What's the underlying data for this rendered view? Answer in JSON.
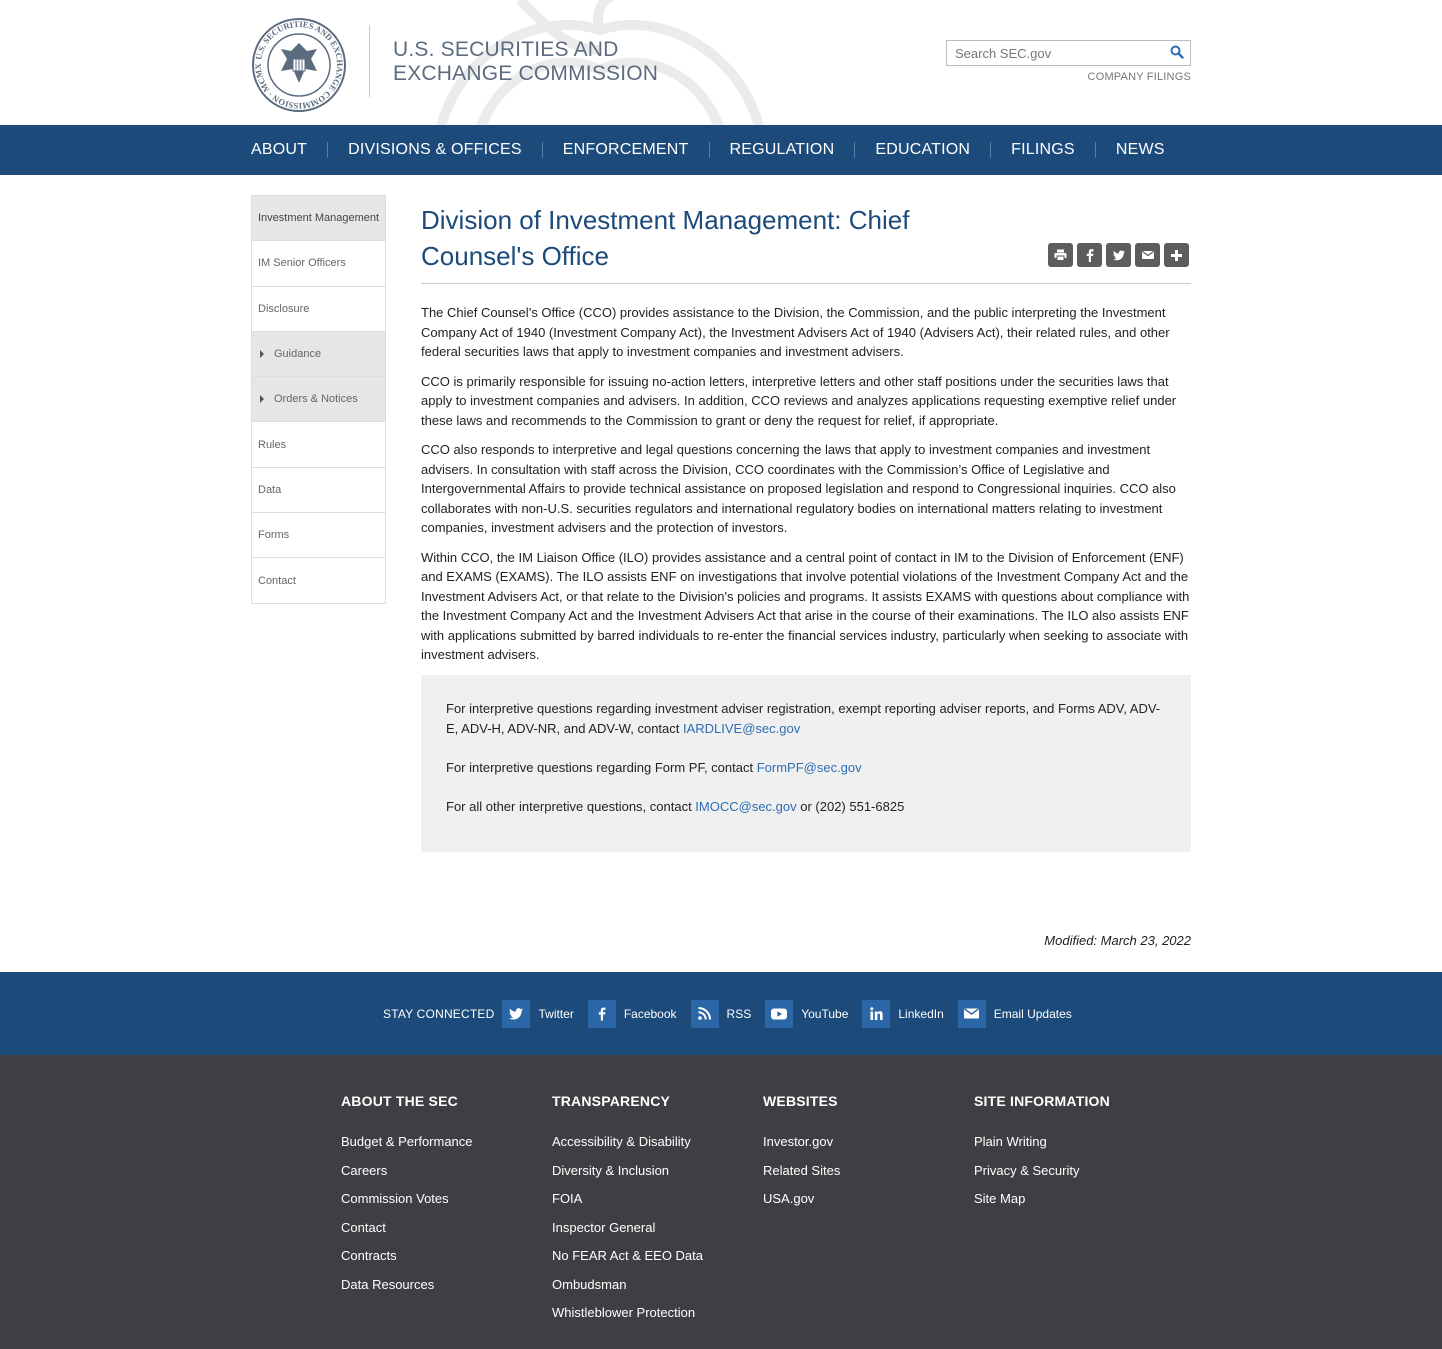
{
  "header": {
    "agency_line1": "U.S. SECURITIES AND",
    "agency_line2": "EXCHANGE COMMISSION",
    "seal_text": "U.S. SECURITIES AND EXCHANGE COMMISSION · MCMXXXIV",
    "search_placeholder": "Search SEC.gov",
    "company_filings": "COMPANY FILINGS"
  },
  "nav": {
    "items": [
      "ABOUT",
      "DIVISIONS & OFFICES",
      "ENFORCEMENT",
      "REGULATION",
      "EDUCATION",
      "FILINGS",
      "NEWS"
    ]
  },
  "sidebar": {
    "items": [
      {
        "label": "Investment Management"
      },
      {
        "label": "IM Senior Officers"
      },
      {
        "label": "Disclosure"
      },
      {
        "label": "Guidance"
      },
      {
        "label": "Orders & Notices"
      },
      {
        "label": "Rules"
      },
      {
        "label": "Data"
      },
      {
        "label": "Forms"
      },
      {
        "label": "Contact"
      }
    ]
  },
  "main": {
    "title": "Division of Investment Management: Chief Counsel's Office",
    "share_icons": [
      "print-icon",
      "facebook-icon",
      "twitter-icon",
      "email-icon",
      "plus-icon"
    ],
    "paragraphs": [
      "The Chief Counsel’s Office (CCO) provides assistance to the Division, the Commission, and the public interpreting the Investment Company Act of 1940 (Investment Company Act), the Investment Advisers Act of 1940 (Advisers Act), their related rules, and other federal securities laws that apply to investment companies and investment advisers.",
      "CCO is primarily responsible for issuing no-action letters, interpretive letters and other staff positions under the securities laws that apply to investment companies and advisers. In addition, CCO reviews and analyzes applications requesting exemptive relief under these laws and recommends to the Commission to grant or deny the request for relief, if appropriate.",
      "CCO also responds to interpretive and legal questions concerning the laws that apply to investment companies and investment advisers. In consultation with staff across the Division, CCO coordinates with the Commission’s Office of Legislative and Intergovernmental Affairs to provide technical assistance on proposed legislation and respond to Congressional inquiries. CCO also collaborates with non-U.S. securities regulators and international regulatory bodies on international matters relating to investment companies, investment advisers and the protection of investors.",
      "Within CCO, the IM Liaison Office (ILO) provides assistance and a central point of contact in IM to the Division of Enforcement (ENF) and EXAMS (EXAMS). The ILO assists ENF on investigations that involve potential violations of the Investment Company Act and the Investment Advisers Act, or that relate to the Division's policies and programs. It assists EXAMS with questions about compliance with the Investment Company Act and the Investment Advisers Act that arise in the course of their examinations. The ILO also assists ENF with applications submitted by barred individuals to re-enter the financial services industry, particularly when seeking to associate with investment advisers."
    ],
    "contact": {
      "line1_text": "For interpretive questions regarding investment adviser registration, exempt reporting adviser reports, and Forms ADV, ADV-E, ADV-H, ADV-NR, and ADV-W, contact ",
      "line1_email": "IARDLIVE@sec.gov",
      "line2_text": "For interpretive questions regarding Form PF, contact ",
      "line2_email": "FormPF@sec.gov",
      "line3_text": "For all other interpretive questions, contact ",
      "line3_email": "IMOCC@sec.gov",
      "line3_suffix": " or (202) 551-6825"
    },
    "modified": "Modified: March 23, 2022"
  },
  "stay_connected": {
    "label": "STAY CONNECTED",
    "links": [
      {
        "label": "Twitter",
        "icon": "twitter-icon"
      },
      {
        "label": "Facebook",
        "icon": "facebook-icon"
      },
      {
        "label": "RSS",
        "icon": "rss-icon"
      },
      {
        "label": "YouTube",
        "icon": "youtube-icon"
      },
      {
        "label": "LinkedIn",
        "icon": "linkedin-icon"
      },
      {
        "label": "Email Updates",
        "icon": "email-icon"
      }
    ]
  },
  "footer": {
    "columns": [
      {
        "heading": "ABOUT THE SEC",
        "links": [
          "Budget & Performance",
          "Careers",
          "Commission Votes",
          "Contact",
          "Contracts",
          "Data Resources"
        ]
      },
      {
        "heading": "TRANSPARENCY",
        "links": [
          "Accessibility & Disability",
          "Diversity & Inclusion",
          "FOIA",
          "Inspector General",
          "No FEAR Act & EEO Data",
          "Ombudsman",
          "Whistleblower Protection"
        ]
      },
      {
        "heading": "WEBSITES",
        "links": [
          "Investor.gov",
          "Related Sites",
          "USA.gov"
        ]
      },
      {
        "heading": "SITE INFORMATION",
        "links": [
          "Plain Writing",
          "Privacy & Security",
          "Site Map"
        ]
      }
    ]
  },
  "colors": {
    "nav_bg": "#1c4a7a",
    "title": "#1c4a7a",
    "link": "#2d6eb5",
    "footer_bg": "#3d3f42",
    "social_square": "#2b66a6"
  }
}
